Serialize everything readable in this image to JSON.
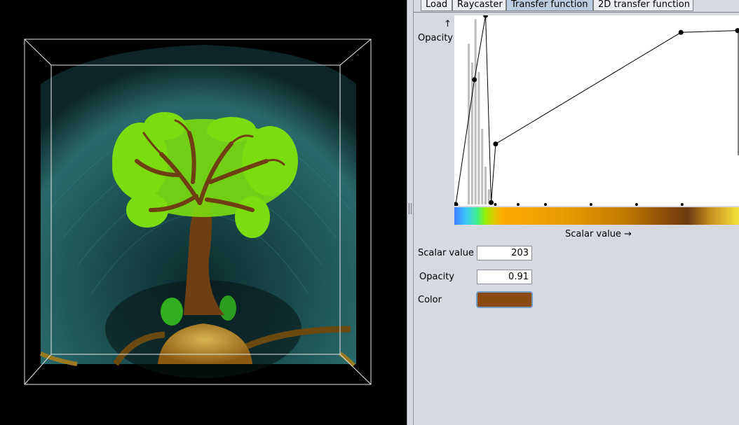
{
  "tabs": [
    {
      "label": "Load"
    },
    {
      "label": "Raycaster"
    },
    {
      "label": "Transfer function"
    },
    {
      "label": "2D transfer function"
    }
  ],
  "plot": {
    "y_label": "Opacity",
    "y_arrow": "↑",
    "x_label": "Scalar value →"
  },
  "chart_data": {
    "type": "line",
    "title": "",
    "xlabel": "Scalar value",
    "ylabel": "Opacity",
    "ylim": [
      0,
      1
    ],
    "control_points": [
      {
        "x": 0,
        "y": 0.0
      },
      {
        "x": 18,
        "y": 0.66
      },
      {
        "x": 28,
        "y": 1.0
      },
      {
        "x": 33,
        "y": 0.01
      },
      {
        "x": 37,
        "y": 0.32
      },
      {
        "x": 203,
        "y": 0.91
      },
      {
        "x": 255,
        "y": 0.92
      }
    ]
  },
  "selected_point": {
    "scalar_label": "Scalar value",
    "scalar_value": "203",
    "opacity_label": "Opacity",
    "opacity_value": "0.91",
    "color_label": "Color",
    "color_hex": "#8b4a10"
  }
}
